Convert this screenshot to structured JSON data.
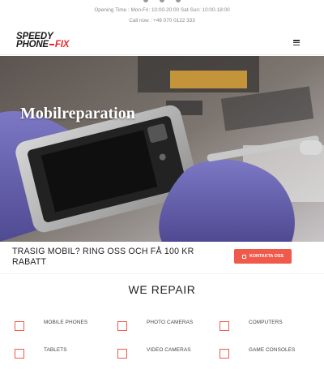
{
  "topbar": {
    "opening_time": "Opening Time : Mon-Fri: 10:00-20:00  Sat-Sun: 10:00-18:00",
    "call_now": "Call now : +46 070 0122 333"
  },
  "brand": {
    "line1": "SPEEDY",
    "line2a": "PHONE",
    "line2b": "FIX",
    "accent_color": "#e8262c"
  },
  "nav": {
    "menu_icon": "hamburger-icon"
  },
  "hero": {
    "title": "Mobilreparation"
  },
  "promo": {
    "text": "TRASIG MOBIL? RING OSS OCH FÅ 100 KR RABATT",
    "button_label": "KONTAKTA OSS",
    "button_icon": "contact-icon",
    "button_color": "#f05a4b"
  },
  "repair": {
    "title": "WE REPAIR",
    "items": [
      {
        "label": "MOBILE PHONES",
        "icon": "mobile-phone-icon"
      },
      {
        "label": "PHOTO CAMERAS",
        "icon": "camera-icon"
      },
      {
        "label": "COMPUTERS",
        "icon": "computer-icon"
      },
      {
        "label": "TABLETS",
        "icon": "tablet-icon"
      },
      {
        "label": "VIDEO CAMERAS",
        "icon": "video-camera-icon"
      },
      {
        "label": "GAME CONSOLES",
        "icon": "game-console-icon"
      }
    ]
  }
}
